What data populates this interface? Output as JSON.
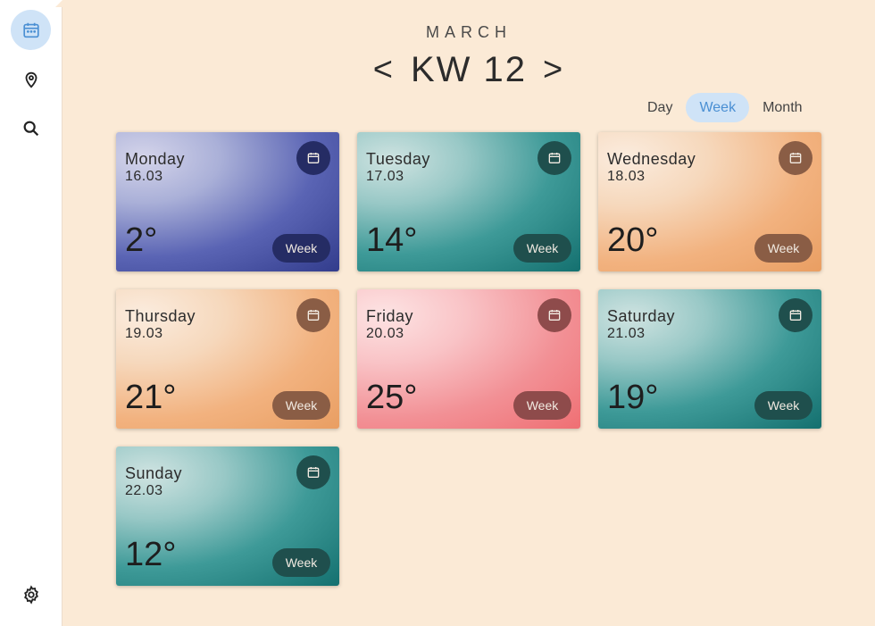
{
  "header": {
    "month": "MARCH",
    "week_label": "KW 12",
    "prev_symbol": "<",
    "next_symbol": ">"
  },
  "view_toggle": {
    "options": [
      "Day",
      "Week",
      "Month"
    ],
    "selected": "Week"
  },
  "sidebar": {
    "items": [
      {
        "icon": "calendar-icon",
        "active": true
      },
      {
        "icon": "location-pin-icon",
        "active": false
      },
      {
        "icon": "search-icon",
        "active": false
      },
      {
        "icon": "gear-icon",
        "active": false
      }
    ]
  },
  "days": [
    {
      "day": "Monday",
      "date": "16.03",
      "temp": "2°",
      "button": "Week",
      "theme": "blue"
    },
    {
      "day": "Tuesday",
      "date": "17.03",
      "temp": "14°",
      "button": "Week",
      "theme": "teal"
    },
    {
      "day": "Wednesday",
      "date": "18.03",
      "temp": "20°",
      "button": "Week",
      "theme": "orange"
    },
    {
      "day": "Thursday",
      "date": "19.03",
      "temp": "21°",
      "button": "Week",
      "theme": "orange"
    },
    {
      "day": "Friday",
      "date": "20.03",
      "temp": "25°",
      "button": "Week",
      "theme": "pink"
    },
    {
      "day": "Saturday",
      "date": "21.03",
      "temp": "19°",
      "button": "Week",
      "theme": "teal"
    },
    {
      "day": "Sunday",
      "date": "22.03",
      "temp": "12°",
      "button": "Week",
      "theme": "teal"
    }
  ],
  "colors": {
    "background": "#fbead6",
    "accent": "#cfe3f7",
    "accent_text": "#4a8fd3"
  }
}
